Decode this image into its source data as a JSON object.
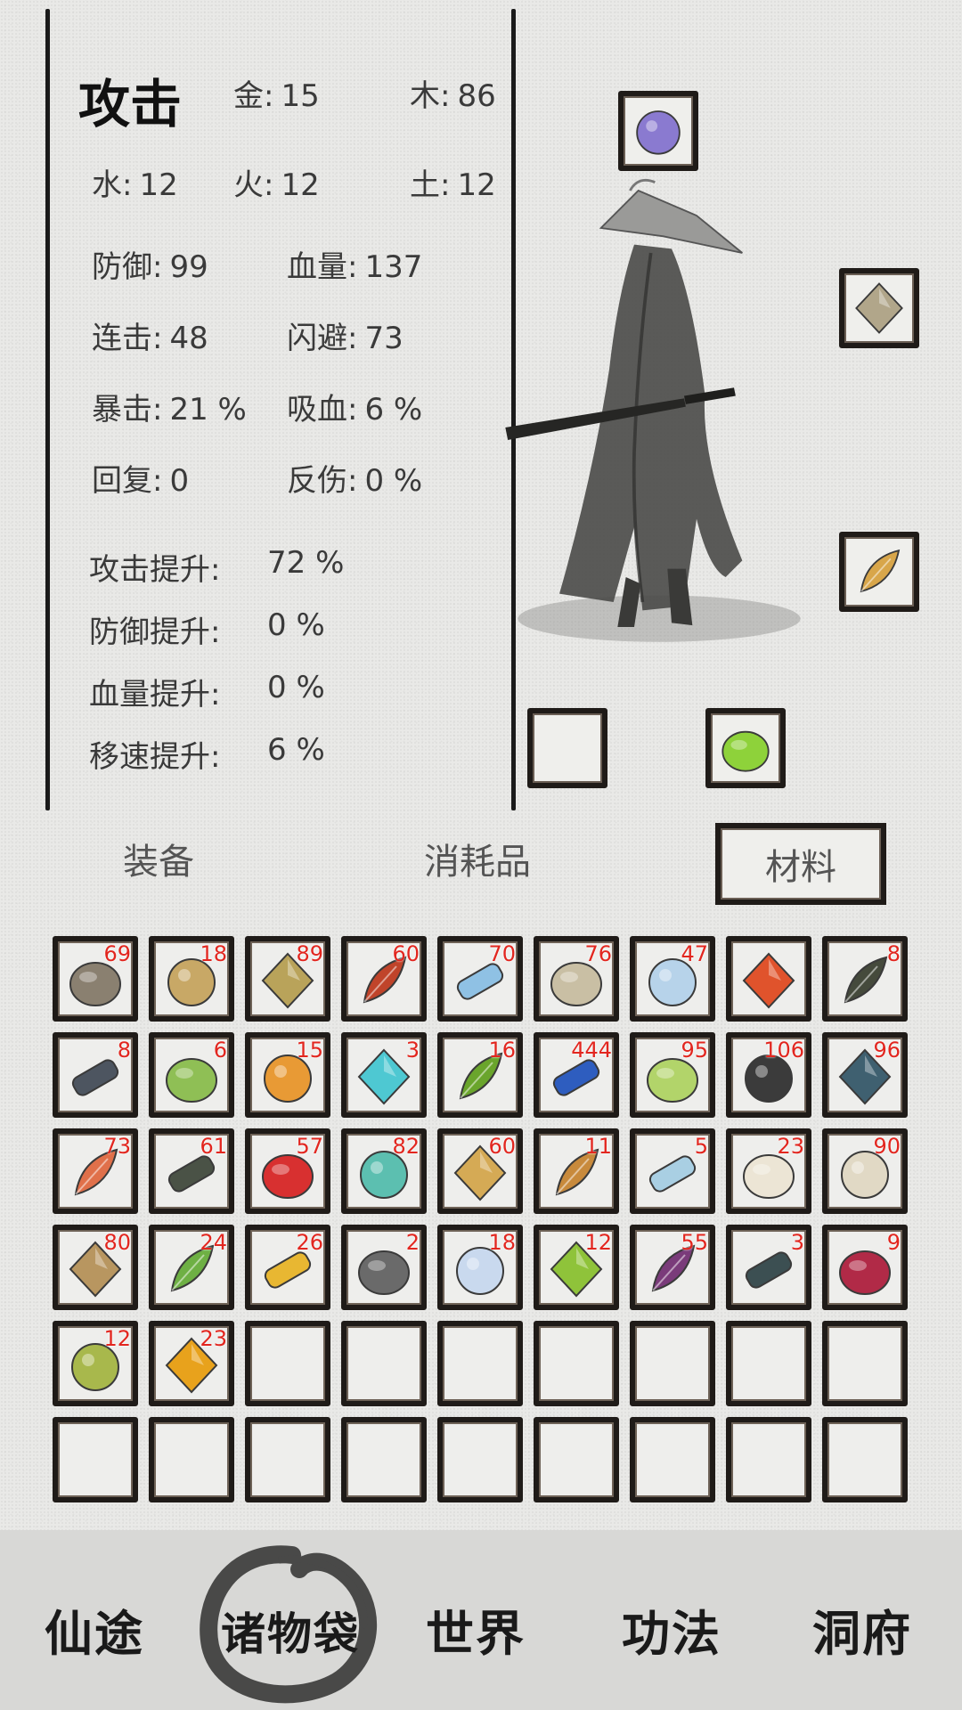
{
  "stats": {
    "title": "攻击",
    "rows": [
      {
        "id": "jin",
        "key": "金",
        "value": "15"
      },
      {
        "id": "mu",
        "key": "木",
        "value": "86"
      },
      {
        "id": "shui",
        "key": "水",
        "value": "12"
      },
      {
        "id": "huo",
        "key": "火",
        "value": "12"
      },
      {
        "id": "tu",
        "key": "土",
        "value": "12"
      },
      {
        "id": "fangyu",
        "key": "防御",
        "value": "99"
      },
      {
        "id": "xueliang",
        "key": "血量",
        "value": "137"
      },
      {
        "id": "lianji",
        "key": "连击",
        "value": "48"
      },
      {
        "id": "shanbi",
        "key": "闪避",
        "value": "73"
      },
      {
        "id": "baoji",
        "key": "暴击",
        "value": "21 %"
      },
      {
        "id": "xixue",
        "key": "吸血",
        "value": "6 %"
      },
      {
        "id": "huifu",
        "key": "回复",
        "value": "0"
      },
      {
        "id": "fanshang",
        "key": "反伤",
        "value": "0 %"
      },
      {
        "id": "gongji-up",
        "key": "攻击提升",
        "value": "72 %"
      },
      {
        "id": "fangyu-up",
        "key": "防御提升",
        "value": "0 %"
      },
      {
        "id": "xueliang-up",
        "key": "血量提升",
        "value": "0 %"
      },
      {
        "id": "yisu-up",
        "key": "移速提升",
        "value": "6 %"
      }
    ],
    "separator": ":"
  },
  "equipment_slots": [
    {
      "id": "slot-top",
      "icon": "talisman-icon",
      "filled": true
    },
    {
      "id": "slot-right-top",
      "icon": "scroll-icon",
      "filled": true
    },
    {
      "id": "slot-right-mid",
      "icon": "vase-icon",
      "filled": true
    },
    {
      "id": "slot-bottom-left",
      "icon": "",
      "filled": false
    },
    {
      "id": "slot-bottom-right",
      "icon": "boots-icon",
      "filled": true
    }
  ],
  "tabs": [
    {
      "id": "equipment",
      "label": "装备",
      "active": false
    },
    {
      "id": "consumables",
      "label": "消耗品",
      "active": false
    },
    {
      "id": "materials",
      "label": "材料",
      "active": true
    }
  ],
  "inventory": {
    "columns": 9,
    "rows": 6,
    "items": [
      {
        "icon": "stone-icon",
        "count": "69",
        "color": "#8a8070"
      },
      {
        "icon": "ginseng-root-icon",
        "count": "18",
        "color": "#c8a866"
      },
      {
        "icon": "mushroom-icon",
        "count": "89",
        "color": "#b9a35a"
      },
      {
        "icon": "red-flower-icon",
        "count": "60",
        "color": "#c0442a"
      },
      {
        "icon": "blue-egg-icon",
        "count": "70",
        "color": "#8fc1e4"
      },
      {
        "icon": "rock-icon",
        "count": "76",
        "color": "#c9bfa4"
      },
      {
        "icon": "crystal-icon",
        "count": "47",
        "color": "#b7d3ea"
      },
      {
        "icon": "red-feather-icon",
        "count": "",
        "color": "#e0532c"
      },
      {
        "icon": "wood-branch-icon",
        "count": "8",
        "color": "#454a3c"
      },
      {
        "icon": "beetle-icon",
        "count": "8",
        "color": "#4d5560"
      },
      {
        "icon": "cauliflower-icon",
        "count": "6",
        "color": "#8fbf55"
      },
      {
        "icon": "carrot-icon",
        "count": "15",
        "color": "#e89a35"
      },
      {
        "icon": "bead-necklace-icon",
        "count": "3",
        "color": "#4ec8d2"
      },
      {
        "icon": "vine-icon",
        "count": "16",
        "color": "#6aa52c"
      },
      {
        "icon": "sapphire-icon",
        "count": "444",
        "color": "#2e5dbf"
      },
      {
        "icon": "green-leaf-icon",
        "count": "95",
        "color": "#b2d46a"
      },
      {
        "icon": "coal-icon",
        "count": "106",
        "color": "#3b3b3b"
      },
      {
        "icon": "dark-fruit-icon",
        "count": "96",
        "color": "#3f6070"
      },
      {
        "icon": "orange-flower-icon",
        "count": "73",
        "color": "#e0704a"
      },
      {
        "icon": "dark-branch-icon",
        "count": "61",
        "color": "#4a5246"
      },
      {
        "icon": "red-gem-icon",
        "count": "57",
        "color": "#d83030"
      },
      {
        "icon": "jade-disc-icon",
        "count": "82",
        "color": "#5cbfb0"
      },
      {
        "icon": "wheat-icon",
        "count": "60",
        "color": "#d5aa55"
      },
      {
        "icon": "nuts-icon",
        "count": "11",
        "color": "#c88a3c"
      },
      {
        "icon": "ice-stone-icon",
        "count": "5",
        "color": "#a9cfe3"
      },
      {
        "icon": "white-flower-icon",
        "count": "23",
        "color": "#ece5d5"
      },
      {
        "icon": "pearl-icon",
        "count": "90",
        "color": "#e1d9c5"
      },
      {
        "icon": "pouch-icon",
        "count": "80",
        "color": "#b89660"
      },
      {
        "icon": "herb-leaf-icon",
        "count": "24",
        "color": "#6eb044"
      },
      {
        "icon": "sunflower-icon",
        "count": "26",
        "color": "#e8b732"
      },
      {
        "icon": "iron-ore-icon",
        "count": "2",
        "color": "#6a6a6a"
      },
      {
        "icon": "lotus-icon",
        "count": "18",
        "color": "#c9d9ee"
      },
      {
        "icon": "sprout-icon",
        "count": "12",
        "color": "#8fc33a"
      },
      {
        "icon": "purple-ore-icon",
        "count": "55",
        "color": "#7a3b7a"
      },
      {
        "icon": "bamboo-icon",
        "count": "3",
        "color": "#3c4f52"
      },
      {
        "icon": "radish-icon",
        "count": "9",
        "color": "#b12a47"
      },
      {
        "icon": "melon-icon",
        "count": "12",
        "color": "#a8b84c"
      },
      {
        "icon": "gold-nugget-icon",
        "count": "23",
        "color": "#e8a21c"
      }
    ]
  },
  "nav": [
    {
      "id": "xiantu",
      "label": "仙途"
    },
    {
      "id": "zhuwudai",
      "label": "诸物袋",
      "active": true
    },
    {
      "id": "shijie",
      "label": "世界"
    },
    {
      "id": "gongfa",
      "label": "功法"
    },
    {
      "id": "dongfu",
      "label": "洞府"
    }
  ]
}
